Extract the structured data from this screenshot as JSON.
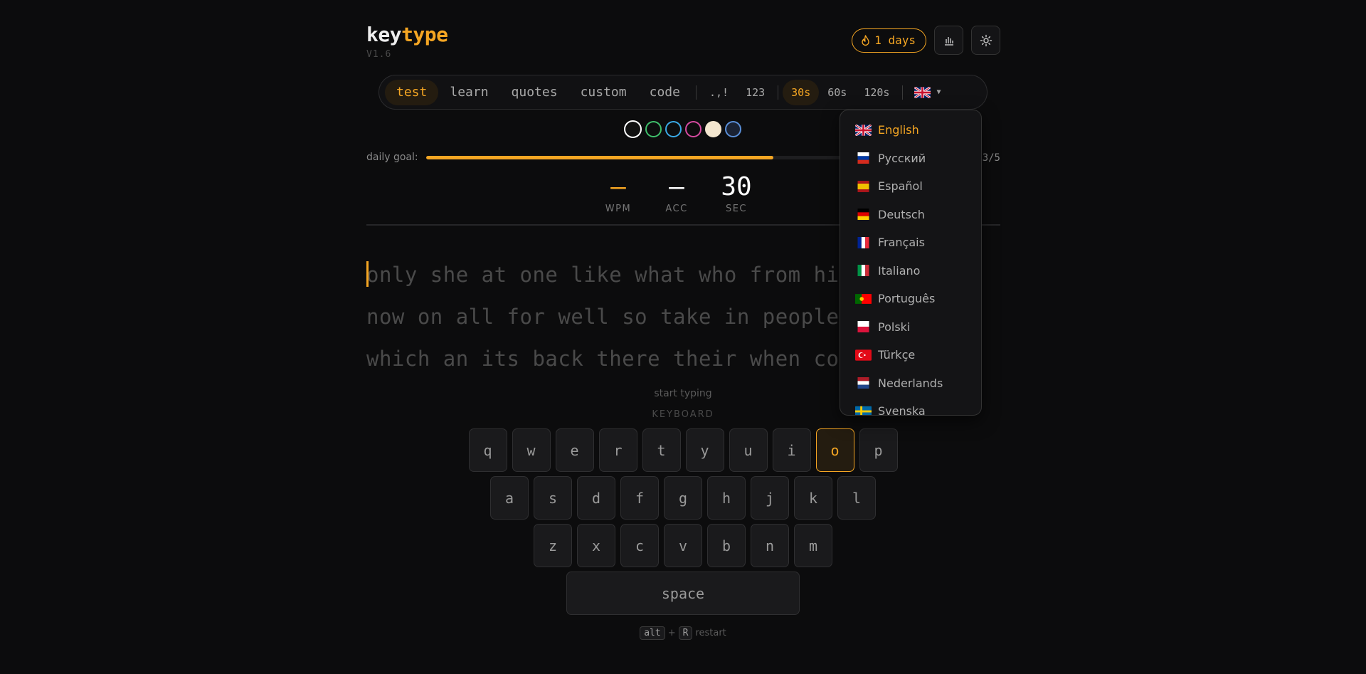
{
  "brand": {
    "word1": "key",
    "word2": "type",
    "version": "V1.6"
  },
  "header": {
    "streak_label": "1 days",
    "stats_icon": "bar-chart-icon",
    "settings_icon": "gear-icon"
  },
  "modes": [
    {
      "label": "test",
      "active": true
    },
    {
      "label": "learn"
    },
    {
      "label": "quotes"
    },
    {
      "label": "custom"
    },
    {
      "label": "code"
    }
  ],
  "options": {
    "punctuation": ".,!",
    "numbers": "123"
  },
  "durations": [
    {
      "label": "30s",
      "active": true
    },
    {
      "label": "60s"
    },
    {
      "label": "120s"
    }
  ],
  "language_selector": {
    "current_flag": "uk-flag"
  },
  "theme_colors": [
    "#ffffff",
    "#3fbf6b",
    "#3aa9e6",
    "#d64aa0",
    "#f3e6cf",
    "#5a8fd8"
  ],
  "daily_goal": {
    "label": "daily goal:",
    "count": "3/5",
    "progress_fraction": 0.64
  },
  "stats": {
    "wpm": {
      "value": "—",
      "label": "WPM"
    },
    "acc": {
      "value": "—",
      "label": "ACC"
    },
    "sec": {
      "value": "30",
      "label": "SEC"
    }
  },
  "text_lines": [
    "only she at one like what who from his",
    "now on all for well so take in people",
    "which an its back there their when cou  er"
  ],
  "hint": "start typing",
  "keyboard": {
    "label": "KEYBOARD",
    "rows": [
      [
        "q",
        "w",
        "e",
        "r",
        "t",
        "y",
        "u",
        "i",
        "o",
        "p"
      ],
      [
        "a",
        "s",
        "d",
        "f",
        "g",
        "h",
        "j",
        "k",
        "l"
      ],
      [
        "z",
        "x",
        "c",
        "v",
        "b",
        "n",
        "m"
      ]
    ],
    "space": "space",
    "highlighted": "o"
  },
  "restart": {
    "key1": "alt",
    "plus": "+",
    "key2": "R",
    "label": "restart"
  },
  "languages": [
    {
      "name": "English",
      "flag": "uk-flag",
      "active": true
    },
    {
      "name": "Русский",
      "flag": "russia-flag"
    },
    {
      "name": "Español",
      "flag": "spain-flag"
    },
    {
      "name": "Deutsch",
      "flag": "germany-flag"
    },
    {
      "name": "Français",
      "flag": "france-flag"
    },
    {
      "name": "Italiano",
      "flag": "italy-flag"
    },
    {
      "name": "Português",
      "flag": "portugal-flag"
    },
    {
      "name": "Polski",
      "flag": "poland-flag"
    },
    {
      "name": "Türkçe",
      "flag": "turkey-flag"
    },
    {
      "name": "Nederlands",
      "flag": "netherlands-flag"
    },
    {
      "name": "Svenska",
      "flag": "sweden-flag"
    }
  ],
  "accent_color": "#f5a623"
}
